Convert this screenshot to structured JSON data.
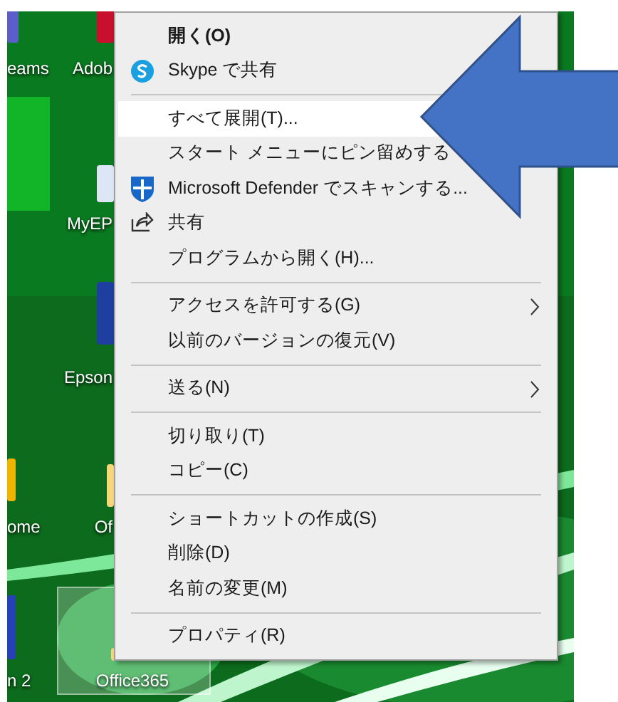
{
  "desktop_icons": [
    {
      "label": "eams",
      "selected": false
    },
    {
      "label": "Adob",
      "selected": false
    },
    {
      "label": "MyEP",
      "selected": false
    },
    {
      "label": "Epson",
      "selected": false
    },
    {
      "label": "ome",
      "selected": false
    },
    {
      "label": "Of",
      "selected": false
    },
    {
      "label": "n 2",
      "selected": false
    },
    {
      "label": "Office365",
      "selected": true
    }
  ],
  "context_menu": {
    "groups": [
      [
        {
          "label": "開く(O)",
          "default": true,
          "selected": false
        },
        {
          "label": "Skype で共有",
          "default": false,
          "selected": false
        }
      ],
      [
        {
          "label": "すべて展開(T)...",
          "default": false,
          "selected": true
        },
        {
          "label": "スタート メニューにピン留めする",
          "default": false,
          "selected": false
        },
        {
          "label": "Microsoft Defender でスキャンする...",
          "default": false,
          "selected": false
        },
        {
          "label": "共有",
          "default": false,
          "selected": false
        },
        {
          "label": "プログラムから開く(H)...",
          "default": false,
          "selected": false
        }
      ],
      [
        {
          "label": "アクセスを許可する(G)",
          "default": false,
          "selected": false,
          "submenu": true
        },
        {
          "label": "以前のバージョンの復元(V)",
          "default": false,
          "selected": false
        }
      ],
      [
        {
          "label": "送る(N)",
          "default": false,
          "selected": false,
          "submenu": true
        }
      ],
      [
        {
          "label": "切り取り(T)",
          "default": false,
          "selected": false
        },
        {
          "label": "コピー(C)",
          "default": false,
          "selected": false
        }
      ],
      [
        {
          "label": "ショートカットの作成(S)",
          "default": false,
          "selected": false
        },
        {
          "label": "削除(D)",
          "default": false,
          "selected": false
        },
        {
          "label": "名前の変更(M)",
          "default": false,
          "selected": false
        }
      ],
      [
        {
          "label": "プロパティ(R)",
          "default": false,
          "selected": false
        }
      ]
    ]
  }
}
